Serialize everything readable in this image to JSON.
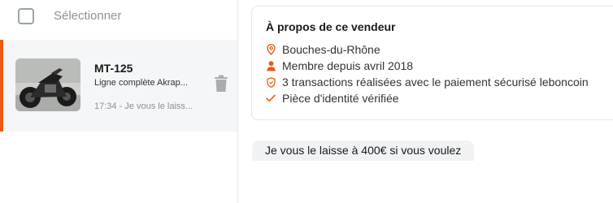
{
  "selection": {
    "label": "Sélectionner"
  },
  "conversation": {
    "title": "MT-125",
    "subtitle": "Ligne complète Akrap...",
    "preview": "17:34 - Je vous le laiss..."
  },
  "seller": {
    "title": "À propos de ce vendeur",
    "location": "Bouches-du-Rhône",
    "member_since": "Membre depuis avril 2018",
    "transactions": "3 transactions réalisées avec le paiement sécurisé leboncoin",
    "id_verified": "Pièce d'identité vérifiée"
  },
  "message": {
    "text": "Je vous le laisse à 400€ si vous voulez"
  },
  "colors": {
    "accent": "#ec5a13",
    "selected_bg": "#f4f6f7",
    "bubble_bg": "#f1f2f3"
  }
}
